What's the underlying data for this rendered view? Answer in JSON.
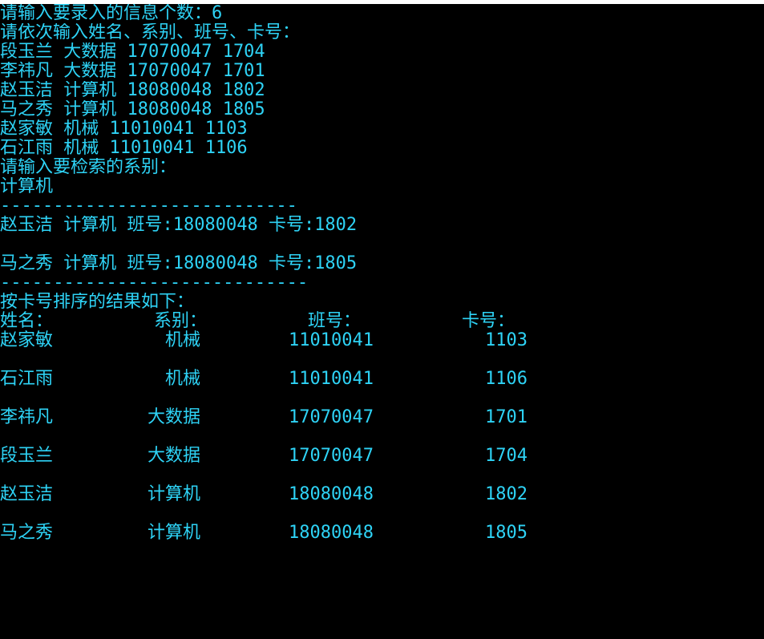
{
  "console": {
    "prompt_count": "请输入要录入的信息个数：6",
    "prompt_input_order": "请依次输入姓名、系别、班号、卡号：",
    "input_lines": [
      "段玉兰 大数据 17070047 1704",
      "李祎凡 大数据 17070047 1701",
      "赵玉洁 计算机 18080048 1802",
      "马之秀 计算机 18080048 1805",
      "赵家敏 机械 11010041 1103",
      "石江雨 机械 11010041 1106"
    ],
    "prompt_search_dept": "请输入要检索的系别：",
    "search_input": "计算机",
    "separator_1": "----------------------------",
    "search_results": [
      "赵玉洁 计算机 班号:18080048 卡号:1802",
      "马之秀 计算机 班号:18080048 卡号:1805"
    ],
    "separator_2": "-----------------------------",
    "sort_title": "按卡号排序的结果如下：",
    "table_headers": {
      "name": "姓名：",
      "dept": "系别：",
      "class": "班号：",
      "card": "卡号："
    },
    "table_rows": [
      {
        "name": "赵家敏",
        "dept": "机械",
        "class": "11010041",
        "card": "1103"
      },
      {
        "name": "石江雨",
        "dept": "机械",
        "class": "11010041",
        "card": "1106"
      },
      {
        "name": "李祎凡",
        "dept": "大数据",
        "class": "17070047",
        "card": "1701"
      },
      {
        "name": "段玉兰",
        "dept": "大数据",
        "class": "17070047",
        "card": "1704"
      },
      {
        "name": "赵玉洁",
        "dept": "计算机",
        "class": "18080048",
        "card": "1802"
      },
      {
        "name": "马之秀",
        "dept": "计算机",
        "class": "18080048",
        "card": "1805"
      }
    ]
  },
  "colors": {
    "background": "#000000",
    "text": "#2ED3F6"
  }
}
